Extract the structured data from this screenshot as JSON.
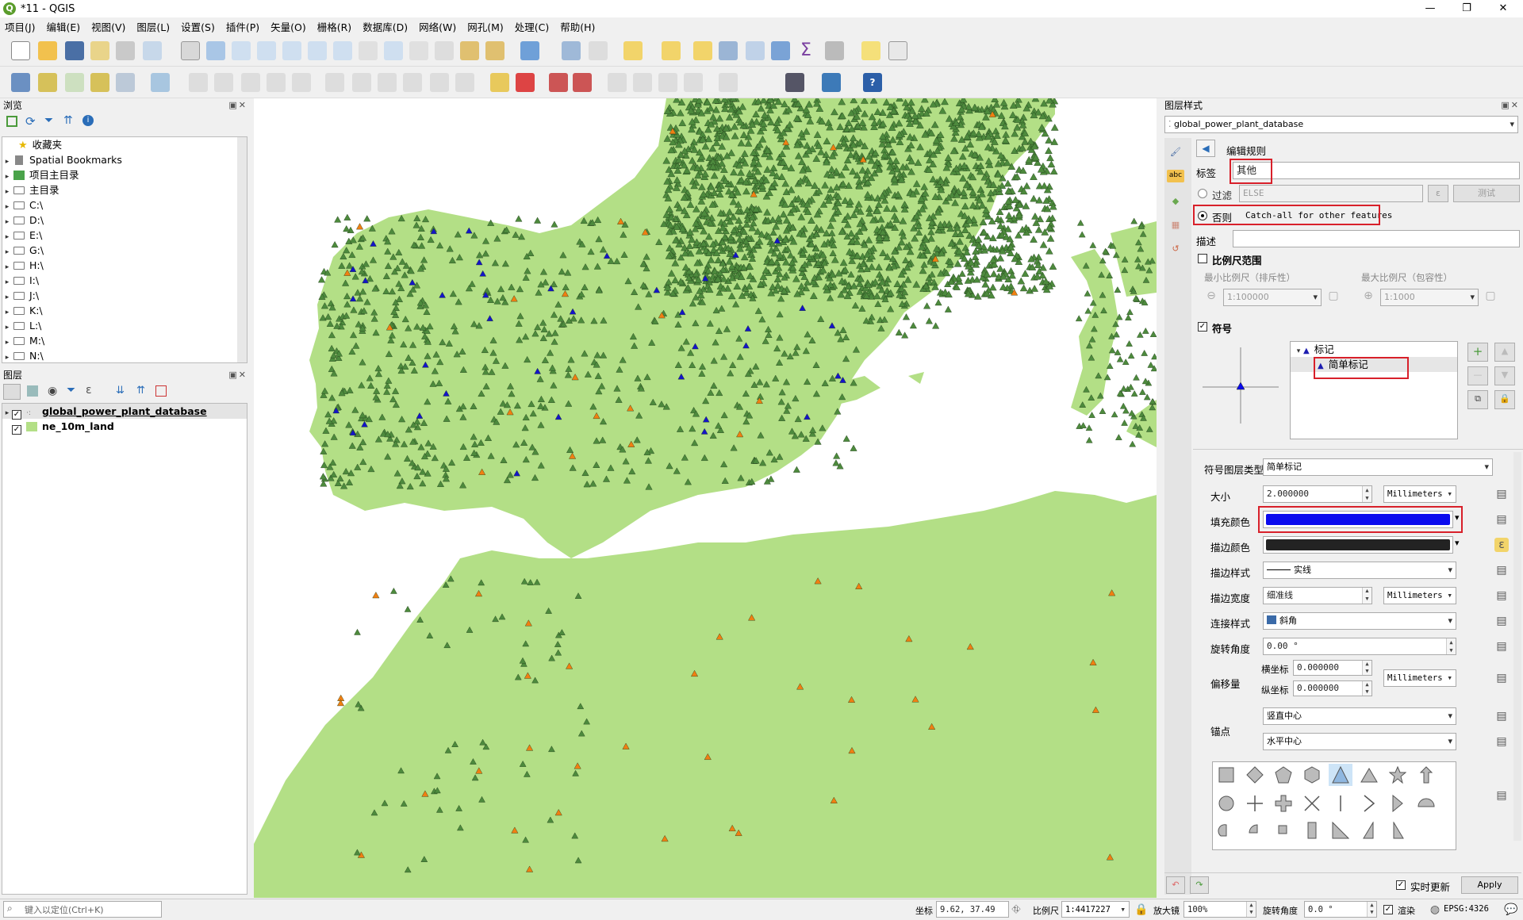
{
  "window": {
    "title": "*11 - QGIS",
    "logo": "Q",
    "min": "—",
    "max": "❐",
    "close": "✕"
  },
  "menu": [
    "项目(J)",
    "编辑(E)",
    "视图(V)",
    "图层(L)",
    "设置(S)",
    "插件(P)",
    "矢量(O)",
    "栅格(R)",
    "数据库(D)",
    "网络(W)",
    "网孔(M)",
    "处理(C)",
    "帮助(H)"
  ],
  "browser": {
    "title": "浏览",
    "items": [
      "收藏夹",
      "Spatial Bookmarks",
      "项目主目录",
      "主目录",
      "C:\\",
      "D:\\",
      "E:\\",
      "G:\\",
      "H:\\",
      "I:\\",
      "J:\\",
      "K:\\",
      "L:\\",
      "M:\\",
      "N:\\"
    ]
  },
  "layers": {
    "title": "图层",
    "items": [
      {
        "name": "global_power_plant_database",
        "checked": true
      },
      {
        "name": "ne_10m_land",
        "checked": true
      }
    ]
  },
  "style_panel": {
    "title": "图层样式",
    "layer_select": "global_power_plant_database",
    "edit_rule": "编辑规则",
    "label_label": "标签",
    "label_value": "其他",
    "filter_label": "过滤",
    "filter_value": "ELSE",
    "test_button": "测试",
    "else_label": "否则",
    "else_text": "Catch-all for other features",
    "desc_label": "描述",
    "desc_value": "",
    "scale_range": "比例尺范围",
    "min_scale_label": "最小比例尺（排斥性）",
    "min_scale_value": "1:100000",
    "max_scale_label": "最大比例尺（包容性）",
    "max_scale_value": "1:1000",
    "symbol_label": "符号",
    "tree_marker": "标记",
    "tree_simple": "简单标记",
    "layer_type_label": "符号图层类型",
    "layer_type_value": "简单标记",
    "size_label": "大小",
    "size_value": "2.000000",
    "units": "Millimeters",
    "fill_label": "填充颜色",
    "fill_color": "#0a0aee",
    "stroke_label": "描边颜色",
    "stroke_color": "#232323",
    "stroke_style_label": "描边样式",
    "stroke_style_value": "实线",
    "stroke_width_label": "描边宽度",
    "stroke_width_value": "细准线",
    "join_label": "连接样式",
    "join_value": "斜角",
    "rotation_label": "旋转角度",
    "rotation_value": "0.00 °",
    "offset_label": "偏移量",
    "offset_x_label": "横坐标",
    "offset_x_value": "0.000000",
    "offset_y_label": "纵坐标",
    "offset_y_value": "0.000000",
    "anchor_label": "锚点",
    "anchor_v": "竖直中心",
    "anchor_h": "水平中心",
    "live_update": "实时更新",
    "apply": "Apply"
  },
  "map": {
    "land_color": "#b3df86",
    "marker_green": "#4d8a3d",
    "marker_orange": "#f07f12",
    "marker_blue": "#1414c8"
  },
  "status": {
    "locate_placeholder": "键入以定位(Ctrl+K)",
    "coord_label": "坐标",
    "coord_value": "9.62, 37.49",
    "scale_label": "比例尺",
    "scale_value": "1:4417227",
    "magnifier_label": "放大镜",
    "magnifier_value": "100%",
    "rotation_label": "旋转角度",
    "rotation_value": "0.0 °",
    "render_label": "渲染",
    "crs": "EPSG:4326"
  }
}
